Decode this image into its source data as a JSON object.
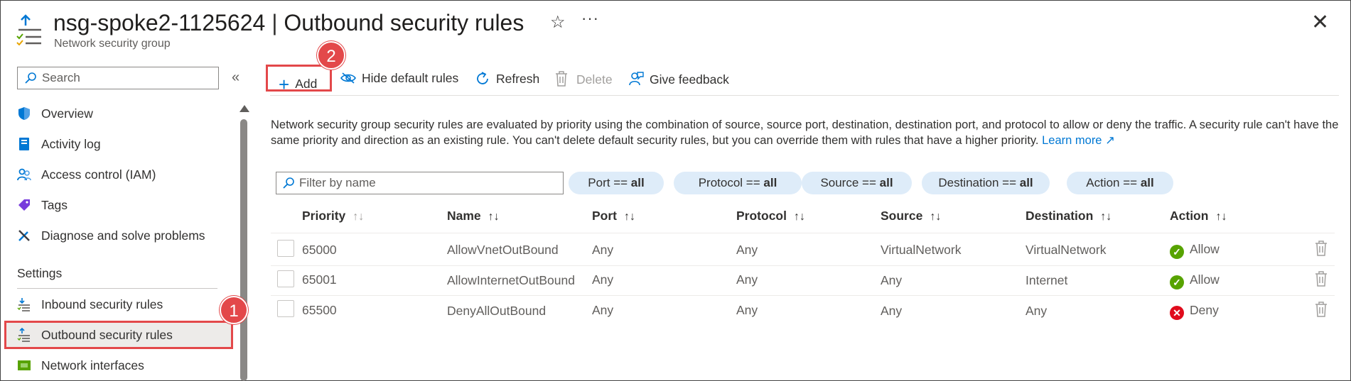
{
  "header": {
    "resource_name": "nsg-spoke2-1125624",
    "separator": "|",
    "blade_title": "Outbound security rules",
    "subtitle": "Network security group",
    "icons": [
      "outbound-rules-icon",
      "star-icon",
      "more-icon",
      "close-icon"
    ]
  },
  "sidebar": {
    "search_placeholder": "Search",
    "collapse_glyph": "«",
    "items": [
      {
        "label": "Overview",
        "icon": "shield-icon"
      },
      {
        "label": "Activity log",
        "icon": "activity-log-icon"
      },
      {
        "label": "Access control (IAM)",
        "icon": "users-icon"
      },
      {
        "label": "Tags",
        "icon": "tag-icon"
      },
      {
        "label": "Diagnose and solve problems",
        "icon": "wrench-icon"
      }
    ],
    "section_settings": "Settings",
    "settings_items": [
      {
        "label": "Inbound security rules",
        "icon": "inbound-rules-icon"
      },
      {
        "label": "Outbound security rules",
        "icon": "outbound-rules-icon",
        "selected": true
      },
      {
        "label": "Network interfaces",
        "icon": "network-interface-icon"
      }
    ]
  },
  "badges": {
    "one": "1",
    "two": "2"
  },
  "toolbar": {
    "add": "Add",
    "hide_default": "Hide default rules",
    "refresh": "Refresh",
    "delete": "Delete",
    "feedback": "Give feedback"
  },
  "description": {
    "text": "Network security group security rules are evaluated by priority using the combination of source, source port, destination, destination port, and protocol to allow or deny the traffic. A security rule can't have the same priority and direction as an existing rule. You can't delete default security rules, but you can override them with rules that have a higher priority.",
    "learn_more": "Learn more"
  },
  "filters": {
    "name_placeholder": "Filter by name",
    "pills": [
      {
        "key": "Port",
        "op": "==",
        "value": "all"
      },
      {
        "key": "Protocol",
        "op": "==",
        "value": "all"
      },
      {
        "key": "Source",
        "op": "==",
        "value": "all"
      },
      {
        "key": "Destination",
        "op": "==",
        "value": "all"
      },
      {
        "key": "Action",
        "op": "==",
        "value": "all"
      }
    ]
  },
  "table": {
    "columns": [
      "Priority",
      "Name",
      "Port",
      "Protocol",
      "Source",
      "Destination",
      "Action"
    ],
    "sort_glyph": "↑↓",
    "rows": [
      {
        "priority": "65000",
        "name": "AllowVnetOutBound",
        "port": "Any",
        "protocol": "Any",
        "source": "VirtualNetwork",
        "destination": "VirtualNetwork",
        "action": "Allow"
      },
      {
        "priority": "65001",
        "name": "AllowInternetOutBound",
        "port": "Any",
        "protocol": "Any",
        "source": "Any",
        "destination": "Internet",
        "action": "Allow"
      },
      {
        "priority": "65500",
        "name": "DenyAllOutBound",
        "port": "Any",
        "protocol": "Any",
        "source": "Any",
        "destination": "Any",
        "action": "Deny"
      }
    ]
  },
  "colors": {
    "allow": "#57a300",
    "deny": "#e00b1c",
    "link": "#0078d4",
    "highlight": "#e3484a",
    "pill_bg": "#deecf9"
  }
}
